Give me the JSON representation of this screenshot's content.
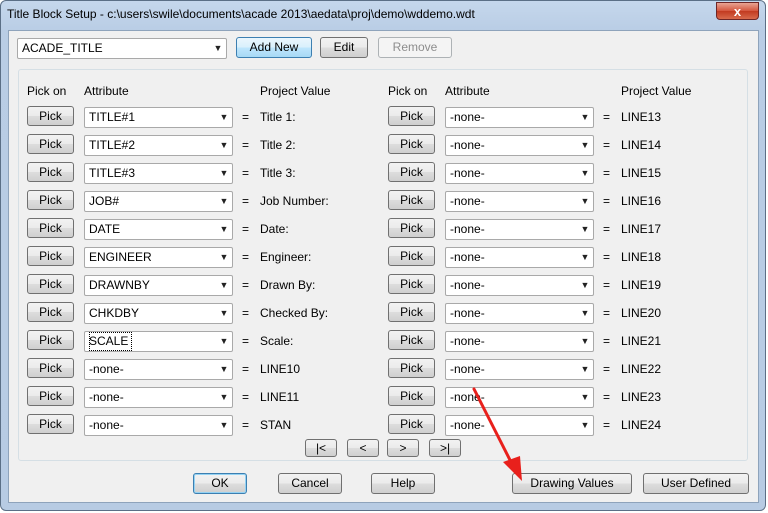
{
  "window": {
    "title": "Title Block Setup - c:\\users\\swile\\documents\\acade 2013\\aedata\\proj\\demo\\wddemo.wdt",
    "close_glyph": "x"
  },
  "top": {
    "block_select": "ACADE_TITLE",
    "add_new": "Add New",
    "edit": "Edit",
    "remove": "Remove"
  },
  "headers": {
    "pick_on": "Pick on",
    "attribute": "Attribute",
    "project_value": "Project Value"
  },
  "pick_label": "Pick",
  "equals": "=",
  "left_rows": [
    {
      "attribute": "TITLE#1",
      "project_value": "Title 1:"
    },
    {
      "attribute": "TITLE#2",
      "project_value": "Title 2:"
    },
    {
      "attribute": "TITLE#3",
      "project_value": "Title 3:"
    },
    {
      "attribute": "JOB#",
      "project_value": "Job Number:"
    },
    {
      "attribute": "DATE",
      "project_value": "Date:"
    },
    {
      "attribute": "ENGINEER",
      "project_value": "Engineer:"
    },
    {
      "attribute": "DRAWNBY",
      "project_value": "Drawn By:"
    },
    {
      "attribute": "CHKDBY",
      "project_value": "Checked By:"
    },
    {
      "attribute": "SCALE",
      "project_value": "Scale:"
    },
    {
      "attribute": "-none-",
      "project_value": "LINE10"
    },
    {
      "attribute": "-none-",
      "project_value": "LINE11"
    },
    {
      "attribute": "-none-",
      "project_value": "STAN"
    }
  ],
  "right_rows": [
    {
      "attribute": "-none-",
      "project_value": "LINE13"
    },
    {
      "attribute": "-none-",
      "project_value": "LINE14"
    },
    {
      "attribute": "-none-",
      "project_value": "LINE15"
    },
    {
      "attribute": "-none-",
      "project_value": "LINE16"
    },
    {
      "attribute": "-none-",
      "project_value": "LINE17"
    },
    {
      "attribute": "-none-",
      "project_value": "LINE18"
    },
    {
      "attribute": "-none-",
      "project_value": "LINE19"
    },
    {
      "attribute": "-none-",
      "project_value": "LINE20"
    },
    {
      "attribute": "-none-",
      "project_value": "LINE21"
    },
    {
      "attribute": "-none-",
      "project_value": "LINE22"
    },
    {
      "attribute": "-none-",
      "project_value": "LINE23"
    },
    {
      "attribute": "-none-",
      "project_value": "LINE24"
    }
  ],
  "nav": {
    "first": "|<",
    "prev": "<",
    "next": ">",
    "last": ">|"
  },
  "footer": {
    "ok": "OK",
    "cancel": "Cancel",
    "help": "Help",
    "drawing_values": "Drawing Values",
    "user_defined": "User Defined"
  },
  "colors": {
    "annotation_arrow": "#e8201c"
  },
  "icons": {
    "dropdown": "chevron-down-icon",
    "annotation": "red-arrow-icon"
  }
}
